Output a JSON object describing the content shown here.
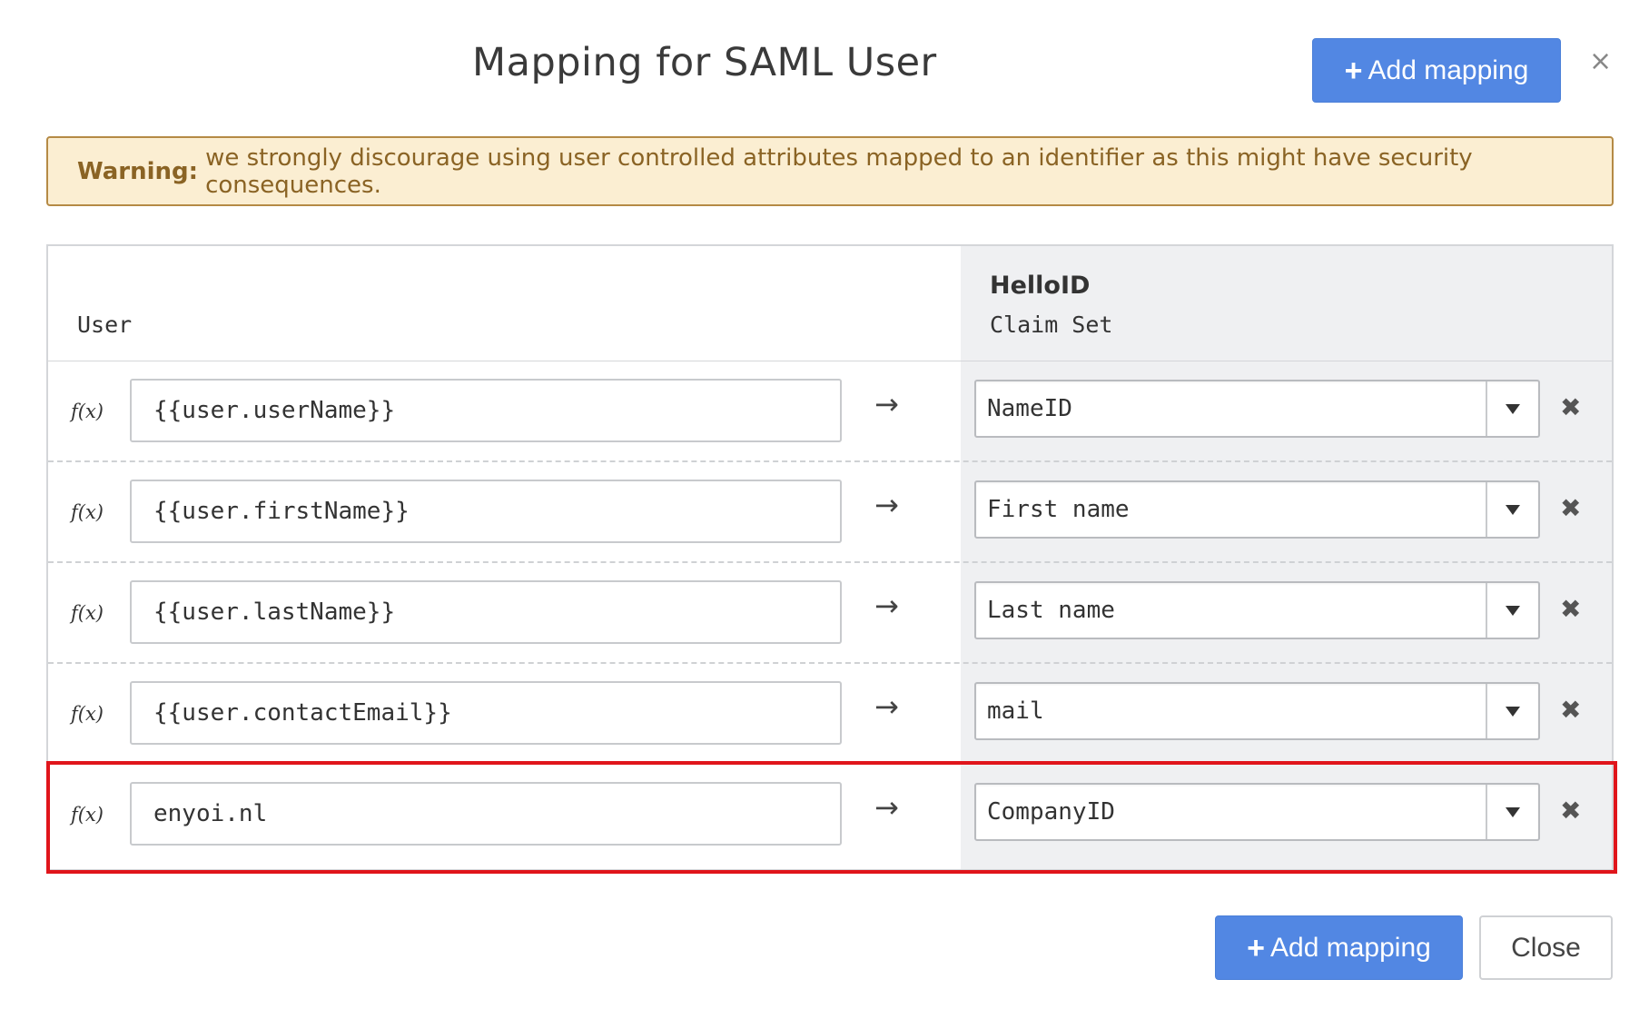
{
  "dialog": {
    "title": "Mapping for SAML User",
    "add_mapping_label": "Add mapping",
    "close_symbol": "×"
  },
  "warning": {
    "label": "Warning:",
    "text": "we strongly discourage using user controlled attributes mapped to an identifier as this might have security consequences."
  },
  "table": {
    "left_header": "User",
    "right_header_title": "HelloID",
    "right_header_subtitle": "Claim Set",
    "fx_label": "f(x)",
    "arrow": "→",
    "delete_symbol": "✖",
    "rows": [
      {
        "source": "{{user.userName}}",
        "target": "NameID"
      },
      {
        "source": "{{user.firstName}}",
        "target": "First name"
      },
      {
        "source": "{{user.lastName}}",
        "target": "Last name"
      },
      {
        "source": "{{user.contactEmail}}",
        "target": "mail"
      },
      {
        "source": "enyoi.nl",
        "target": "CompanyID"
      }
    ]
  },
  "footer": {
    "add_mapping_label": "Add mapping",
    "close_label": "Close"
  },
  "colors": {
    "primary": "#5287e3",
    "warning_bg": "#fbeed2",
    "warning_text": "#8a6324",
    "highlight": "#e0151b"
  }
}
